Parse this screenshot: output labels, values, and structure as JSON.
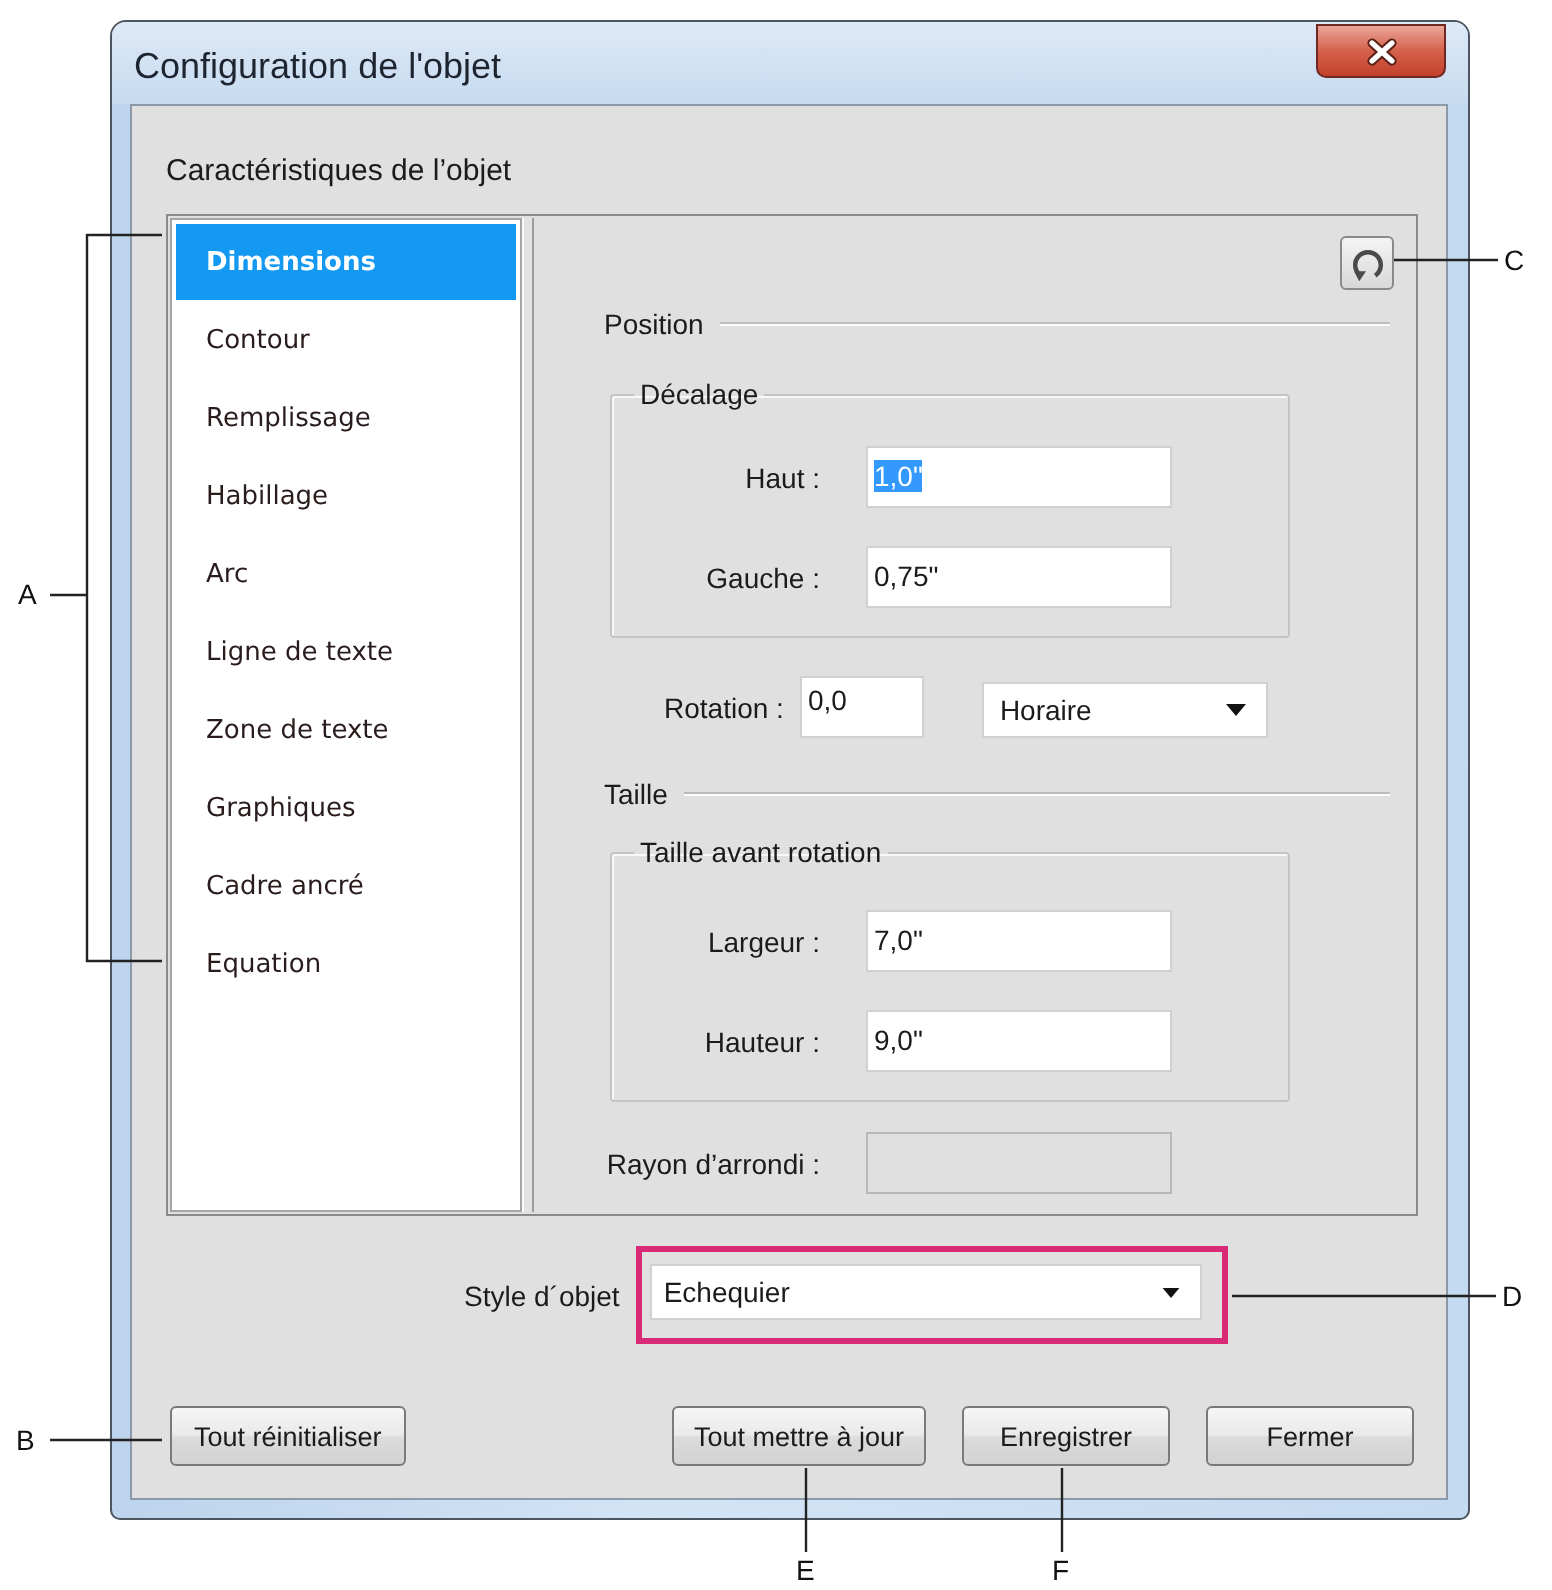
{
  "window": {
    "title": "Configuration de l'objet"
  },
  "section_title": "Caractéristiques de l’objet",
  "sidebar": {
    "items": [
      {
        "label": "Dimensions",
        "selected": true
      },
      {
        "label": "Contour",
        "selected": false
      },
      {
        "label": "Remplissage",
        "selected": false
      },
      {
        "label": "Habillage",
        "selected": false
      },
      {
        "label": "Arc",
        "selected": false
      },
      {
        "label": "Ligne de texte",
        "selected": false
      },
      {
        "label": "Zone de texte",
        "selected": false
      },
      {
        "label": "Graphiques",
        "selected": false
      },
      {
        "label": "Cadre ancré",
        "selected": false
      },
      {
        "label": "Equation",
        "selected": false
      }
    ]
  },
  "panel": {
    "position": {
      "title": "Position",
      "offset": {
        "title": "Décalage",
        "fields": [
          {
            "label": "Haut :",
            "value": "1,0\"",
            "highlighted": true
          },
          {
            "label": "Gauche :",
            "value": "0,75\"",
            "highlighted": false
          }
        ]
      },
      "rotation": {
        "label": "Rotation :",
        "value": "0,0",
        "direction": "Horaire"
      }
    },
    "size": {
      "title": "Taille",
      "before_rotation": {
        "title": "Taille avant rotation",
        "fields": [
          {
            "label": "Largeur :",
            "value": "7,0\""
          },
          {
            "label": "Hauteur :",
            "value": "9,0\""
          }
        ]
      }
    },
    "corner_radius": {
      "label": "Rayon d’arrondi :",
      "disabled": true
    }
  },
  "object_style": {
    "label": "Style d´objet",
    "value": "Echequier",
    "outlined": true
  },
  "buttons": [
    {
      "label": "Tout réinitialiser"
    },
    {
      "label": "Tout mettre à jour"
    },
    {
      "label": "Enregistrer"
    },
    {
      "label": "Fermer"
    }
  ],
  "callouts": [
    {
      "label": "A"
    },
    {
      "label": "B"
    },
    {
      "label": "C"
    },
    {
      "label": "D"
    },
    {
      "label": "E"
    },
    {
      "label": "F"
    }
  ]
}
